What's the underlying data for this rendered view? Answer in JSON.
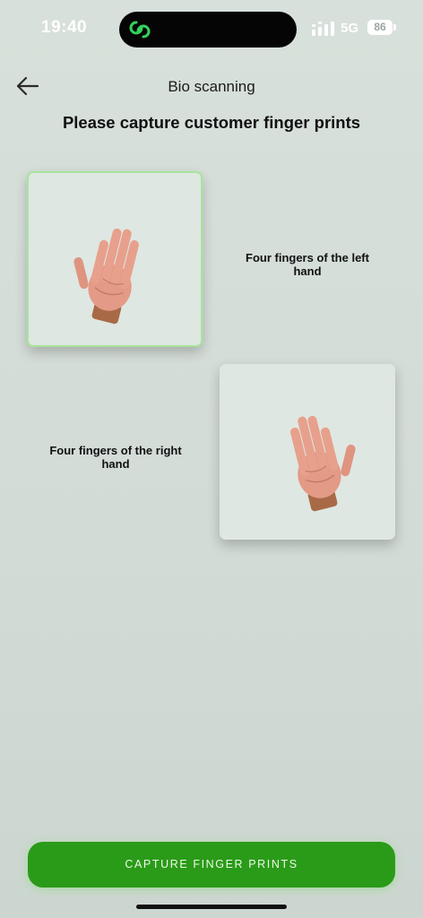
{
  "status_bar": {
    "time": "19:40",
    "network": "5G",
    "battery": "86",
    "icons": {
      "island": "linked-rings-icon",
      "signal": "signal-bars-icon",
      "battery": "battery-icon"
    },
    "accent_color": "#34d15a"
  },
  "header": {
    "back_icon": "arrow-left-icon",
    "title": "Bio scanning"
  },
  "instruction": "Please capture customer finger prints",
  "cards": [
    {
      "label": "Four fingers of the left hand",
      "icon": "left-hand-icon",
      "selected": true
    },
    {
      "label": "Four fingers of the right hand",
      "icon": "right-hand-icon",
      "selected": false
    }
  ],
  "capture_button": {
    "label": "CAPTURE FINGER PRINTS",
    "color": "#2a9b18"
  }
}
